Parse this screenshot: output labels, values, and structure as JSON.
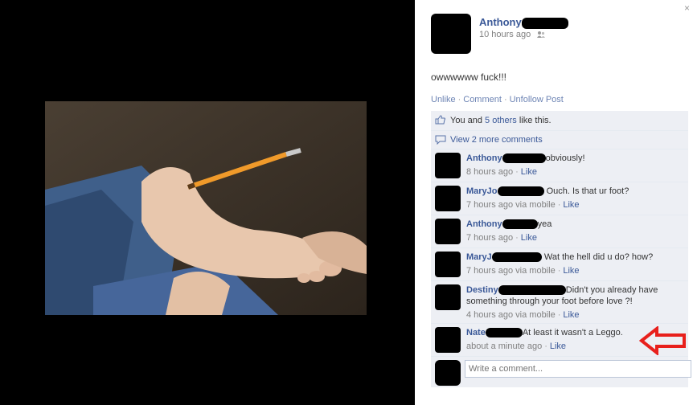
{
  "window": {
    "close_glyph": "×"
  },
  "photo": {
    "description_icon": "photo-of-foot-with-pencil"
  },
  "post": {
    "author_name": "Anthony",
    "timestamp": "10 hours ago",
    "audience_icon": "friends-icon",
    "text": "owwwwww fuck!!!",
    "actions": {
      "unlike": "Unlike",
      "comment": "Comment",
      "unfollow": "Unfollow Post",
      "separator": "·"
    }
  },
  "likes": {
    "prefix": "You and ",
    "others": "5 others",
    "suffix": " like this."
  },
  "view_more": "View 2 more comments",
  "comments": [
    {
      "name": "Anthony",
      "text": "obviously!",
      "time": "8 hours ago",
      "via": "",
      "like": "Like"
    },
    {
      "name": "MaryJo",
      "text": "Ouch. Is that ur foot?",
      "time": "7 hours ago",
      "via": " via mobile",
      "like": "Like"
    },
    {
      "name": "Anthony",
      "text": "yea",
      "time": "7 hours ago",
      "via": "",
      "like": "Like"
    },
    {
      "name": "MaryJ",
      "text": "Wat the hell did u do? how?",
      "time": "7 hours ago",
      "via": " via mobile",
      "like": "Like"
    },
    {
      "name": "Destiny",
      "text": "Didn't you already have something through your foot before love ?!",
      "time": "4 hours ago",
      "via": " via mobile",
      "like": "Like"
    },
    {
      "name": "Nate",
      "text": "At least it wasn't a Leggo.",
      "time": "about a minute ago",
      "via": "",
      "like": "Like"
    }
  ],
  "write_comment": {
    "placeholder": "Write a comment..."
  },
  "colors": {
    "link": "#3b5998",
    "ufi_bg": "#edeff4",
    "arrow": "#e8201c"
  }
}
